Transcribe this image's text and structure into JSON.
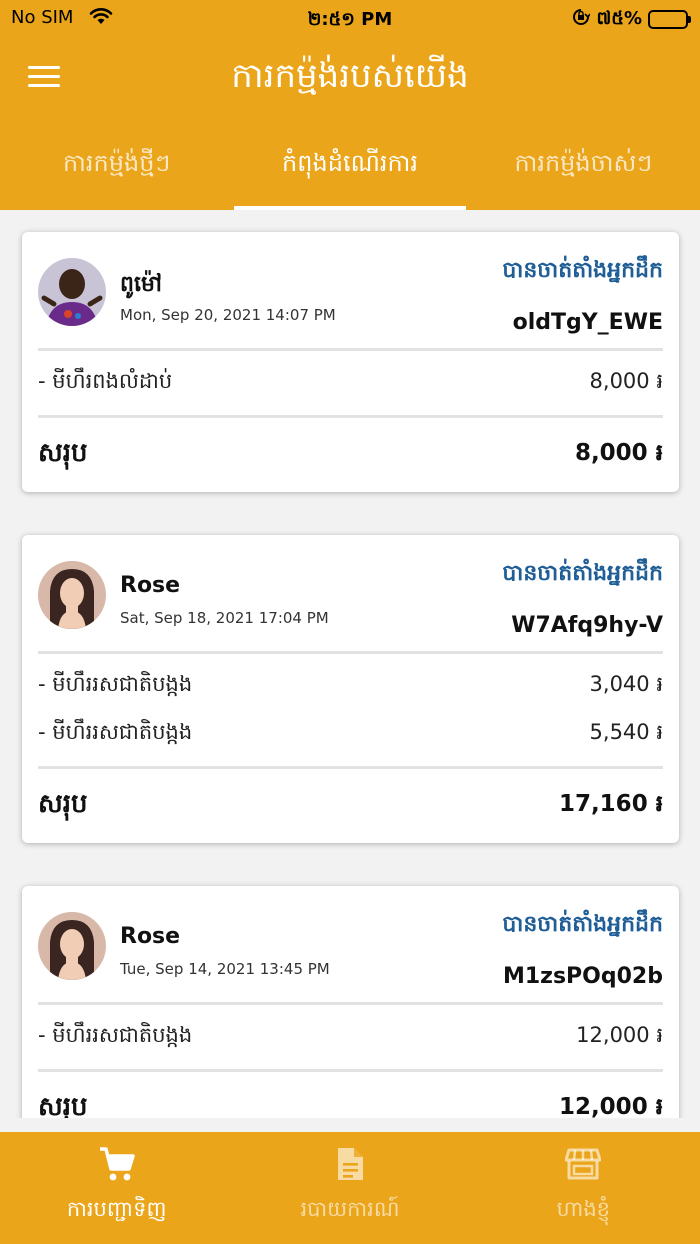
{
  "status_bar": {
    "carrier": "No SIM",
    "time": "២:៥១ PM",
    "battery_pct": "៧៥%",
    "battery_level": 0.75
  },
  "header": {
    "title": "ការកម្ម៉ង់របស់យើង",
    "menu_icon": "hamburger-menu-icon"
  },
  "tabs": [
    {
      "label": "ការកម្ម៉ង់ថ្មីៗ",
      "active": false
    },
    {
      "label": "កំពុងដំណើរការ",
      "active": true
    },
    {
      "label": "ការកម្ម៉ង់ចាស់ៗ",
      "active": false
    }
  ],
  "orders": [
    {
      "customer": "ពូម៉ៅ",
      "datetime": "Mon, Sep 20, 2021 14:07 PM",
      "status": "បានចាត់តាំងអ្នកដឹក",
      "code": "oldTgY_EWE",
      "items": [
        {
          "name": "- មីហឹរពងលំដាប់",
          "price": "8,000 ៛"
        }
      ],
      "total_label": "សរុប",
      "total": "8,000 ៛"
    },
    {
      "customer": "Rose",
      "datetime": "Sat, Sep 18, 2021 17:04 PM",
      "status": "បានចាត់តាំងអ្នកដឹក",
      "code": "W7Afq9hy-V",
      "items": [
        {
          "name": "- មីហឹររសជាតិបង្កង",
          "price": "3,040 ៛"
        },
        {
          "name": "- មីហឹររសជាតិបង្កង",
          "price": "5,540 ៛"
        }
      ],
      "total_label": "សរុប",
      "total": "17,160 ៛"
    },
    {
      "customer": "Rose",
      "datetime": "Tue, Sep 14, 2021 13:45 PM",
      "status": "បានចាត់តាំងអ្នកដឹក",
      "code": "M1zsPOq02b",
      "items": [
        {
          "name": "- មីហឹររសជាតិបង្កង",
          "price": "12,000 ៛"
        }
      ],
      "total_label": "សរុប",
      "total": "12,000 ៛"
    }
  ],
  "bottom_nav": [
    {
      "label": "ការបញ្ជាទិញ",
      "icon": "shopping-cart-icon",
      "active": true
    },
    {
      "label": "របាយការណ៍",
      "icon": "document-icon",
      "active": false
    },
    {
      "label": "ហាងខ្ញុំ",
      "icon": "store-icon",
      "active": false
    }
  ],
  "colors": {
    "brand": "#eba51a",
    "status_blue": "#1f5e96"
  }
}
